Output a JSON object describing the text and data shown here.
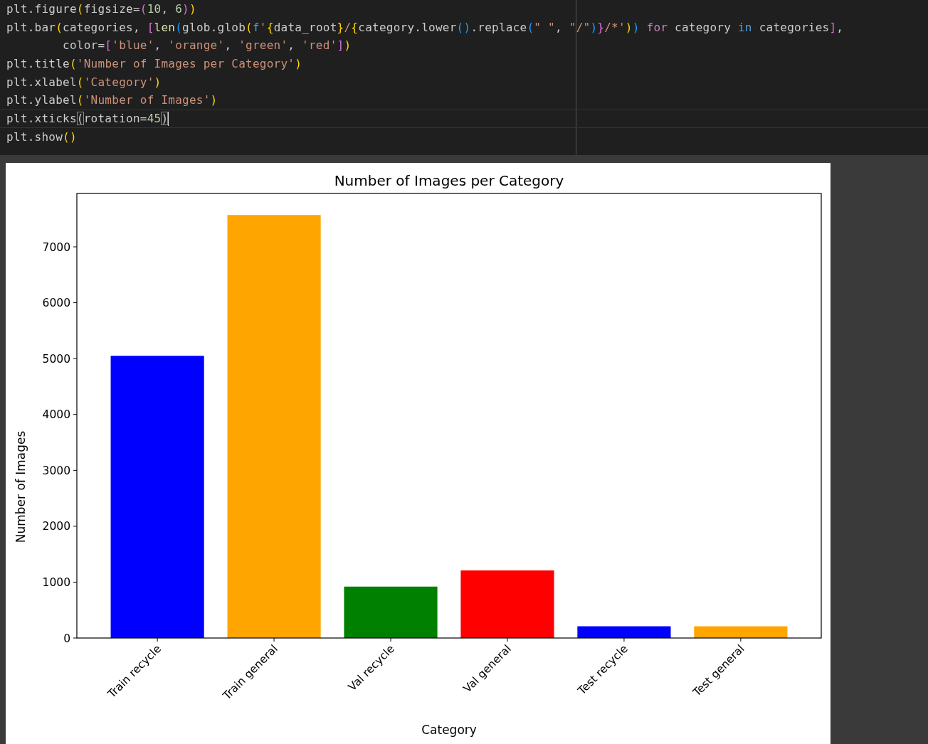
{
  "editor": {
    "lines": [
      {
        "current": false,
        "tokens": [
          {
            "kind": "plain",
            "text": "plt.figure"
          },
          {
            "kind": "b1",
            "text": "("
          },
          {
            "kind": "plain",
            "text": "figsize="
          },
          {
            "kind": "b2",
            "text": "("
          },
          {
            "kind": "num",
            "text": "10"
          },
          {
            "kind": "plain",
            "text": ", "
          },
          {
            "kind": "num",
            "text": "6"
          },
          {
            "kind": "b2",
            "text": ")"
          },
          {
            "kind": "b1",
            "text": ")"
          }
        ]
      },
      {
        "current": false,
        "tokens": [
          {
            "kind": "plain",
            "text": "plt.bar"
          },
          {
            "kind": "b1",
            "text": "("
          },
          {
            "kind": "plain",
            "text": "categories, "
          },
          {
            "kind": "b2",
            "text": "["
          },
          {
            "kind": "fn",
            "text": "len"
          },
          {
            "kind": "b3",
            "text": "("
          },
          {
            "kind": "plain",
            "text": "glob.glob"
          },
          {
            "kind": "b1",
            "text": "("
          },
          {
            "kind": "kw2",
            "text": "f"
          },
          {
            "kind": "str",
            "text": "'"
          },
          {
            "kind": "b1",
            "text": "{"
          },
          {
            "kind": "plain",
            "text": "data_root"
          },
          {
            "kind": "b1",
            "text": "}"
          },
          {
            "kind": "str",
            "text": "/"
          },
          {
            "kind": "b1",
            "text": "{"
          },
          {
            "kind": "plain",
            "text": "category.lower"
          },
          {
            "kind": "b3",
            "text": "()"
          },
          {
            "kind": "plain",
            "text": ".replace"
          },
          {
            "kind": "b3",
            "text": "("
          },
          {
            "kind": "str",
            "text": "\" \""
          },
          {
            "kind": "plain",
            "text": ", "
          },
          {
            "kind": "str",
            "text": "\"/\""
          },
          {
            "kind": "b3",
            "text": ")"
          },
          {
            "kind": "b2",
            "text": "}"
          },
          {
            "kind": "str",
            "text": "/*'"
          },
          {
            "kind": "b1",
            "text": ")"
          },
          {
            "kind": "b3",
            "text": ") "
          },
          {
            "kind": "kw",
            "text": "for"
          },
          {
            "kind": "plain",
            "text": " category "
          },
          {
            "kind": "kw2",
            "text": "in"
          },
          {
            "kind": "plain",
            "text": " categories"
          },
          {
            "kind": "b2",
            "text": "]"
          },
          {
            "kind": "plain",
            "text": ","
          }
        ]
      },
      {
        "current": false,
        "tokens": [
          {
            "kind": "plain",
            "text": "        color="
          },
          {
            "kind": "b2",
            "text": "["
          },
          {
            "kind": "str",
            "text": "'blue'"
          },
          {
            "kind": "plain",
            "text": ", "
          },
          {
            "kind": "str",
            "text": "'orange'"
          },
          {
            "kind": "plain",
            "text": ", "
          },
          {
            "kind": "str",
            "text": "'green'"
          },
          {
            "kind": "plain",
            "text": ", "
          },
          {
            "kind": "str",
            "text": "'red'"
          },
          {
            "kind": "b2",
            "text": "]"
          },
          {
            "kind": "b1",
            "text": ")"
          }
        ]
      },
      {
        "current": false,
        "tokens": [
          {
            "kind": "plain",
            "text": "plt.title"
          },
          {
            "kind": "b1",
            "text": "("
          },
          {
            "kind": "str",
            "text": "'Number of Images per Category'"
          },
          {
            "kind": "b1",
            "text": ")"
          }
        ]
      },
      {
        "current": false,
        "tokens": [
          {
            "kind": "plain",
            "text": "plt.xlabel"
          },
          {
            "kind": "b1",
            "text": "("
          },
          {
            "kind": "str",
            "text": "'Category'"
          },
          {
            "kind": "b1",
            "text": ")"
          }
        ]
      },
      {
        "current": false,
        "tokens": [
          {
            "kind": "plain",
            "text": "plt.ylabel"
          },
          {
            "kind": "b1",
            "text": "("
          },
          {
            "kind": "str",
            "text": "'Number of Images'"
          },
          {
            "kind": "b1",
            "text": ")"
          }
        ]
      },
      {
        "current": true,
        "tokens": [
          {
            "kind": "plain",
            "text": "plt.xticks"
          },
          {
            "kind": "match",
            "text": "("
          },
          {
            "kind": "plain",
            "text": "rotation="
          },
          {
            "kind": "num",
            "text": "45"
          },
          {
            "kind": "match",
            "text": ")"
          }
        ]
      },
      {
        "current": false,
        "tokens": [
          {
            "kind": "plain",
            "text": "plt.show"
          },
          {
            "kind": "b1",
            "text": "()"
          }
        ]
      }
    ]
  },
  "plot": {
    "chart_data": {
      "type": "bar",
      "title": "Number of Images per Category",
      "xlabel": "Category",
      "ylabel": "Number of Images",
      "categories": [
        "Train recycle",
        "Train general",
        "Val recycle",
        "Val general",
        "Test recycle",
        "Test general"
      ],
      "series": [
        {
          "values": [
            5050,
            7570,
            920,
            1210,
            210,
            210
          ],
          "colors": [
            "#0000ff",
            "#ffa500",
            "#008000",
            "#ff0000",
            "#0000ff",
            "#ffa500"
          ]
        }
      ],
      "ylim": [
        0,
        7955
      ],
      "yticks": [
        0,
        1000,
        2000,
        3000,
        4000,
        5000,
        6000,
        7000
      ]
    }
  }
}
